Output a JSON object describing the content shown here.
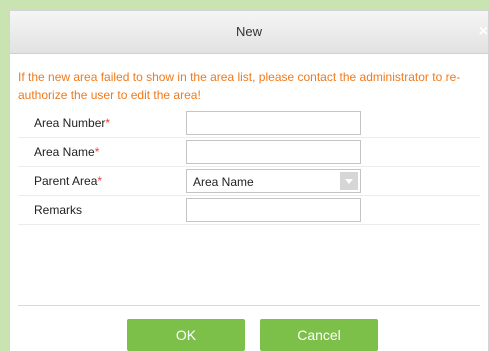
{
  "dialog": {
    "title": "New",
    "close_symbol": "×",
    "notice": "If the new area failed to show in the area list, please contact the administrator to re-authorize the user to edit the area!"
  },
  "fields": [
    {
      "label": "Area Number",
      "required_mark": "*",
      "value": ""
    },
    {
      "label": "Area Name",
      "required_mark": "*",
      "value": ""
    },
    {
      "label": "Parent Area",
      "required_mark": "*",
      "value": "Area Name"
    },
    {
      "label": "Remarks",
      "required_mark": "",
      "value": ""
    }
  ],
  "buttons": {
    "ok": "OK",
    "cancel": "Cancel"
  },
  "colors": {
    "notice": "#f07a1c",
    "button": "#7cc04a",
    "required": "#e8433b"
  },
  "icons": {
    "close": "close-icon",
    "dropdown": "chevron-down-icon"
  }
}
